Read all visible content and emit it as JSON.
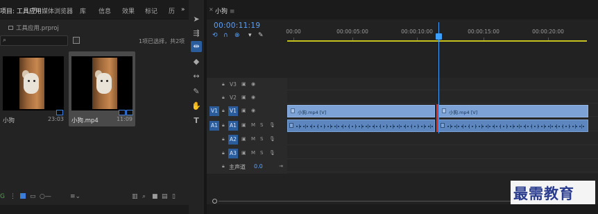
{
  "project_panel": {
    "tabs": [
      "项目: 工具应用",
      "≡",
      "媒体浏览器",
      "库",
      "信息",
      "效果",
      "标记",
      "历",
      "»"
    ],
    "project_file": "工具应用.prproj",
    "search_placeholder": "",
    "selection_info": "1项已选择，共2项",
    "clips": [
      {
        "name": "小狗",
        "duration": "23:03",
        "selected": false
      },
      {
        "name": "小狗.mp4",
        "duration": "11:09",
        "selected": true
      }
    ],
    "bottom_icons": [
      "list-view-icon",
      "icon-view-icon",
      "freeform-view-icon",
      "zoom-slider",
      "sort-icon",
      "automate-icon",
      "find-icon",
      "new-bin-icon",
      "new-item-icon",
      "clear-icon"
    ]
  },
  "tools": [
    "selection-tool",
    "track-select-tool",
    "ripple-edit-tool",
    "razor-tool",
    "slip-tool",
    "pen-tool",
    "hand-tool",
    "type-tool"
  ],
  "timeline": {
    "sequence_name": "小狗",
    "menu_glyph": "≡",
    "timecode": "00:00:11:19",
    "ruler_labels": [
      "00:00",
      "00:00:05:00",
      "00:00:10:00",
      "00:00:15:00",
      "00:00:20:00"
    ],
    "video_tracks": [
      {
        "source": "",
        "name": "V3"
      },
      {
        "source": "",
        "name": "V2"
      },
      {
        "source": "V1",
        "name": "V1"
      }
    ],
    "audio_tracks": [
      {
        "source": "A1",
        "name": "A1"
      },
      {
        "source": "",
        "name": "A2"
      },
      {
        "source": "",
        "name": "A3"
      }
    ],
    "mute_label": "M",
    "solo_label": "S",
    "master": {
      "label": "主声道",
      "value": "0.0"
    },
    "video_clips": [
      {
        "label": "小狗.mp4 [V]"
      },
      {
        "label": "小狗.mp4 [V]"
      }
    ]
  },
  "watermark": "最需教育",
  "colors": {
    "accent": "#2b5d9c",
    "timecode": "#5aa2ff",
    "video_clip": "#7da3d6",
    "audio_clip": "#5c86bd",
    "work_area": "#c6c21e",
    "edit_point": "#d93535"
  }
}
